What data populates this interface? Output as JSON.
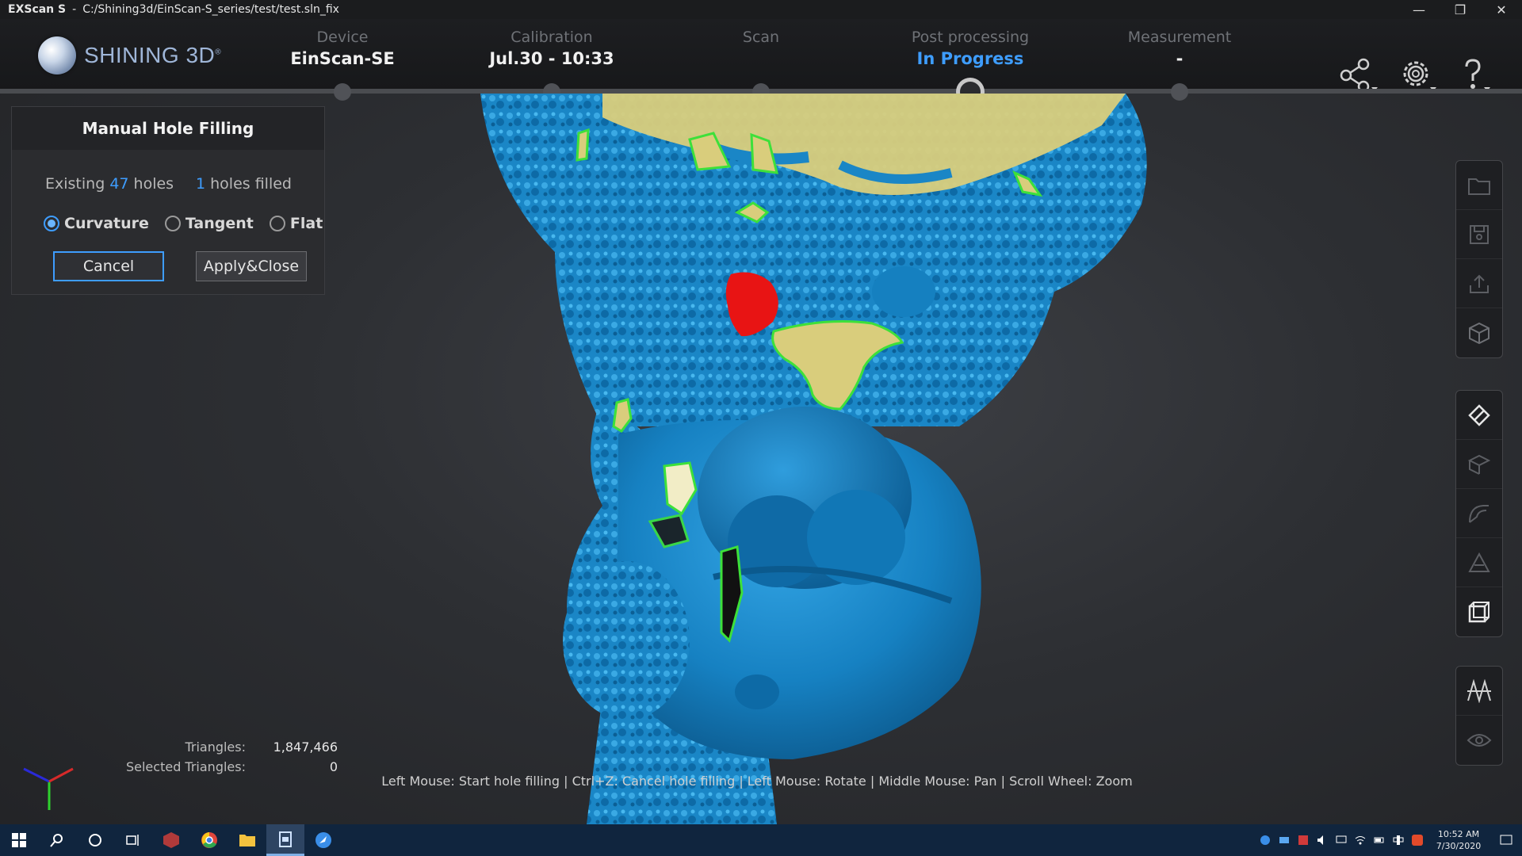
{
  "window": {
    "app_name": "EXScan S",
    "separator": "-",
    "path": "C:/Shining3d/EinScan-S_series/test/test.sln_fix",
    "controls": [
      "—",
      "❐",
      "✕"
    ]
  },
  "header": {
    "logo_text": "SHINING 3D",
    "logo_mark": "®",
    "steps": [
      {
        "label": "Device",
        "value": "EinScan-SE"
      },
      {
        "label": "Calibration",
        "value": "Jul.30 - 10:33"
      },
      {
        "label": "Scan",
        "value": ""
      },
      {
        "label": "Post processing",
        "value": "In Progress"
      },
      {
        "label": "Measurement",
        "value": "-"
      }
    ],
    "active_step": 3,
    "icons": [
      "share-icon",
      "settings-icon",
      "help-icon"
    ],
    "accent_color": "#3e9dff"
  },
  "panel": {
    "title": "Manual Hole Filling",
    "existing_prefix": "Existing",
    "existing_count": "47",
    "existing_suffix": "holes",
    "filled_count": "1",
    "filled_suffix": "holes filled",
    "modes": [
      {
        "label": "Curvature",
        "checked": true
      },
      {
        "label": "Tangent",
        "checked": false
      },
      {
        "label": "Flat",
        "checked": false
      }
    ],
    "cancel_label": "Cancel",
    "apply_label": "Apply&Close"
  },
  "stats": {
    "triangles_label": "Triangles:",
    "triangles_value": "1,847,466",
    "selected_label": "Selected Triangles:",
    "selected_value": "0"
  },
  "hint": "Left Mouse: Start hole filling | Ctrl+Z: Cancel hole filling | Left Mouse: Rotate | Middle Mouse: Pan | Scroll Wheel: Zoom",
  "toolbar": {
    "group1": [
      "folder-icon",
      "save-icon",
      "export-icon",
      "cube-icon"
    ],
    "group2": [
      "eraser-icon",
      "plane-cut-icon",
      "curve-icon",
      "mesh-triangle-icon",
      "box-icon"
    ],
    "group3": [
      "mirror-icon",
      "eye-icon"
    ]
  },
  "taskbar": {
    "clock_time": "10:52 AM",
    "clock_date": "7/30/2020",
    "colors": {
      "bg": "#10253e"
    }
  }
}
